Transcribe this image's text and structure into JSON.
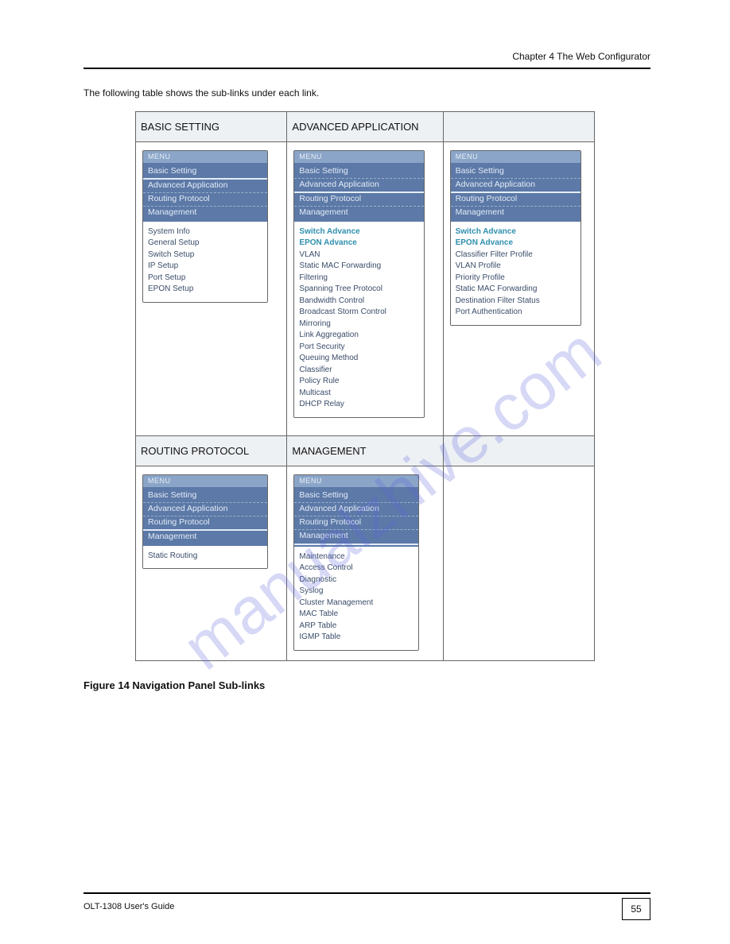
{
  "header_right": "Chapter 4 The Web Configurator",
  "intro_text": "The following table shows the sub-links under each link.",
  "table_headers": {
    "col1": "BASIC SETTING",
    "col2": "ADVANCED APPLICATION",
    "col3": ""
  },
  "table_headers_row2": {
    "col1": "ROUTING PROTOCOL",
    "col2": "MANAGEMENT",
    "col3": ""
  },
  "panel": {
    "tab": "MENU",
    "nav": [
      "Basic Setting",
      "Advanced Application",
      "Routing Protocol",
      "Management"
    ]
  },
  "panels": {
    "basic": {
      "items": [
        "System Info",
        "General Setup",
        "Switch Setup",
        "IP Setup",
        "Port Setup",
        "EPON Setup"
      ]
    },
    "adv_switch": {
      "head1": "Switch Advance",
      "head2": "EPON Advance",
      "items": [
        "VLAN",
        "Static MAC Forwarding",
        "Filtering",
        "Spanning Tree Protocol",
        "Bandwidth Control",
        "Broadcast Storm Control",
        "Mirroring",
        "Link Aggregation",
        "Port Security",
        "Queuing Method",
        "Classifier",
        "Policy Rule",
        "Multicast",
        "DHCP Relay"
      ]
    },
    "adv_epon": {
      "head1": "Switch Advance",
      "head2": "EPON Advance",
      "items": [
        "Classifier Filter Profile",
        "VLAN Profile",
        "Priority Profile",
        "Static MAC Forwarding",
        "Destination Filter Status",
        "Port Authentication"
      ]
    },
    "routing": {
      "items": [
        "Static Routing"
      ]
    },
    "mgmt": {
      "items": [
        "Maintenance",
        "Access Control",
        "Diagnostic",
        "Syslog",
        "Cluster Management",
        "MAC Table",
        "ARP Table",
        "IGMP Table"
      ]
    }
  },
  "caption": "Figure 14   Navigation Panel Sub-links",
  "footer_left": "OLT-1308 User's Guide",
  "page_number": "55",
  "watermark": "manualzhive.com"
}
